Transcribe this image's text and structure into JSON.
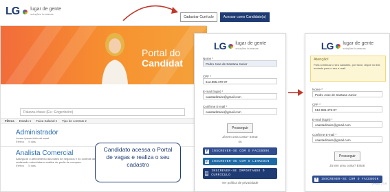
{
  "brand": {
    "mark": "LG",
    "name": "lugar de gente",
    "tagline": "soluções humanas"
  },
  "top_buttons": {
    "register_cv": "Cadastrar Currículo",
    "access_applications": "Acessar como Candidato(a)"
  },
  "portal": {
    "banner_line1": "Portal do",
    "banner_line2": "Candidat",
    "search_placeholder": "Palavra-chave (Ex.: Engenheiro)",
    "filters": {
      "label": "Filtros",
      "f1": "Estado ▾",
      "f2": "Faixa Salarial ▾",
      "f3": "Tipo de contrato ▾"
    },
    "jobs": [
      {
        "title": "Administrador",
        "text": "Lorem ipsum dolor sit amet",
        "company": "Efetivo",
        "time": "5 dias"
      },
      {
        "title": "Analista Comercial",
        "text": "Assegurar o atendimento das fases de negócios e no controle da produção, realizando entrevistas e análise de perfis de compras.",
        "company": "Efetivo",
        "time": "5 dias"
      }
    ]
  },
  "callout": "Candidato acessa o Portal de vagas e realiza o seu cadastro",
  "signup1": {
    "name_label": "Nome *",
    "name_value": "Pedro Jose de Santana Junior",
    "cpf_label": "CPF *",
    "cpf_value": "512.985.479-07",
    "email_label": "E-mail (login) *",
    "email_value": "caastadizaire@gmail.com",
    "confirm_label": "Confirme E-mail *",
    "confirm_value": "caastadizaire@gmail.com",
    "proceed": "Prosseguir",
    "have_account": "Já tem uma conta? Entrar",
    "or": "ou",
    "social_fb": "INSCREVER-SE COM O FACEBOOK",
    "social_li": "INSCREVER-SE COM O LINKEDIN",
    "social_cv": "INSCREVER-SE IMPORTANDO O CURRÍCULO",
    "privacy": "Ver política de privacidade"
  },
  "signup2": {
    "alert_title": "Atenção!",
    "alert_text": "Para continuar o seu cadastro, por favor, clique no link enviado para o seu e-mail.",
    "name_label": "Nome *",
    "name_value": "Pedro Jose de Santana Junior",
    "cpf_label": "CPF *",
    "cpf_value": "512.985.479-07",
    "email_label": "E-mail (login) *",
    "email_value": "caastadizaire@gmail.com",
    "confirm_label": "Confirme E-mail *",
    "confirm_value": "caastadizaire@gmail.com",
    "proceed": "Prosseguir",
    "have_account": "Já tem uma conta? Entrar",
    "social_fb": "INSCREVER-SE COM O FACEBOOK"
  },
  "watermark": "Versão 2.1.0",
  "colors": {
    "navy": "#1f3b73",
    "orange": "#f26c3a",
    "link_blue": "#2a6db0",
    "red_arrow": "#c0392b"
  }
}
